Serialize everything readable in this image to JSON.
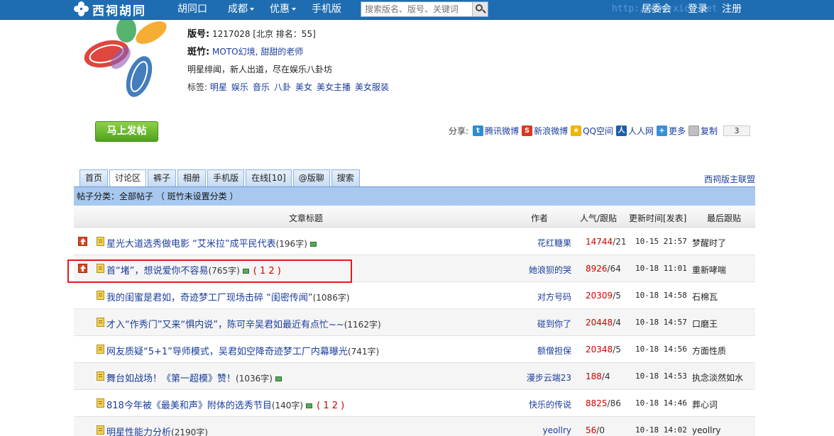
{
  "topbar": {
    "logo_text": "西祠胡同",
    "nav": [
      {
        "label": "胡同口",
        "has_caret": false
      },
      {
        "label": "成都",
        "has_caret": true
      },
      {
        "label": "优惠",
        "has_caret": true
      },
      {
        "label": "手机版",
        "has_caret": false
      }
    ],
    "search_placeholder": "搜索版名、版号、关键词",
    "ghost_url": "http://www.xici.net",
    "right_links": [
      "居委会",
      "登录",
      "注册"
    ]
  },
  "board": {
    "id_label": "版号:",
    "id_value": "1217028",
    "region": "[北京  排名：55]",
    "moderator_label": "斑竹:",
    "moderators": "MOTO幻境, 甜甜的老师",
    "description": "明星绯闻，新人出道，尽在娱乐八卦坊",
    "tags_label": "标签:",
    "tags": [
      "明星",
      "娱乐",
      "音乐",
      "八卦",
      "美女",
      "美女主播",
      "美女服装"
    ]
  },
  "post_button": "马上发帖",
  "share": {
    "label": "分享:",
    "items": [
      {
        "label": "腾讯微博",
        "icon": "tencent-weibo-icon",
        "color": "#2c8fd1",
        "glyph": "t"
      },
      {
        "label": "新浪微博",
        "icon": "sina-weibo-icon",
        "color": "#d9381e",
        "glyph": "S"
      },
      {
        "label": "QQ空间",
        "icon": "qzone-icon",
        "color": "#f0b400",
        "glyph": "★"
      },
      {
        "label": "人人网",
        "icon": "renren-icon",
        "color": "#1d5ea8",
        "glyph": "人"
      },
      {
        "label": "更多",
        "icon": "more-icon",
        "color": "#3b8fd8",
        "glyph": "+"
      },
      {
        "label": "复制",
        "icon": "copy-icon",
        "color": "#bfbfbf",
        "glyph": ""
      }
    ],
    "count": "3"
  },
  "tabs": [
    "首页",
    "讨论区",
    "裤子",
    "相册",
    "手机版",
    "在线[10]",
    "@版聊",
    "搜索"
  ],
  "active_tab": 1,
  "union_link": "西祠版主联盟",
  "category_bar": "帖子分类：全部帖子  （ 斑竹未设置分类 ）",
  "columns": {
    "title": "文章标题",
    "author": "作者",
    "hits": "人气/跟贴",
    "updated": "更新时间[发表]",
    "lastby": "最后跟贴"
  },
  "rows": [
    {
      "pinned": true,
      "title": "星光大道选秀做电影 “艾米拉”成平民代表",
      "len": "(196字)",
      "img": true,
      "pages": "",
      "author": "花红糖果",
      "hits": "14744",
      "replies": "/21",
      "updated": "10-15 21:57",
      "lastby": "梦醒时了"
    },
    {
      "pinned": true,
      "title": "首“堵”，想说爱你不容易",
      "len": "(765字)",
      "img": true,
      "pages": "( 1 2 )",
      "author": "她浪狈的哭",
      "hits": "8926",
      "replies": "/64",
      "updated": "10-18 11:01",
      "lastby": "重新哮喘"
    },
    {
      "pinned": false,
      "title": "我的闺蜜是君如，奇迹梦工厂现场击碎 “闺密传闻”",
      "len": "(1086字)",
      "img": false,
      "pages": "",
      "author": "对方号码",
      "hits": "20309",
      "replies": "/5",
      "updated": "10-18 14:58",
      "lastby": "石棉瓦"
    },
    {
      "pinned": false,
      "title": "才入“作秀门”又来“惧内说”，陈可辛吴君如最近有点忙~~",
      "len": "(1162字)",
      "img": false,
      "pages": "",
      "author": "碰到你了",
      "hits": "20448",
      "replies": "/4",
      "updated": "10-18 14:57",
      "lastby": "口磨王"
    },
    {
      "pinned": false,
      "title": "网友质疑“5+1”导师模式，吴君如空降奇迹梦工厂内幕曝光",
      "len": "(741字)",
      "img": false,
      "pages": "",
      "author": "额僧担保",
      "hits": "20348",
      "replies": "/5",
      "updated": "10-18 14:56",
      "lastby": "方面性质"
    },
    {
      "pinned": false,
      "title": "舞台如战场！《第一超模》赞！",
      "len": "(1036字)",
      "img": true,
      "pages": "",
      "author": "漫步云端23",
      "hits": "188",
      "replies": "/4",
      "updated": "10-18 14:53",
      "lastby": "执念淡然如水"
    },
    {
      "pinned": false,
      "title": "818今年被《最美和声》附体的选秀节目",
      "len": "(140字)",
      "img": true,
      "pages": "( 1 2 )",
      "author": "快乐的传说",
      "hits": "8825",
      "replies": "/86",
      "updated": "10-18 14:46",
      "lastby": "葬心词"
    },
    {
      "pinned": false,
      "title": "明星性能力分析",
      "len": "(2190字)",
      "img": false,
      "pages": "",
      "author": "yeollry",
      "hits": "56",
      "replies": "/0",
      "updated": "10-18 14:02",
      "lastby": "yeollry"
    }
  ]
}
